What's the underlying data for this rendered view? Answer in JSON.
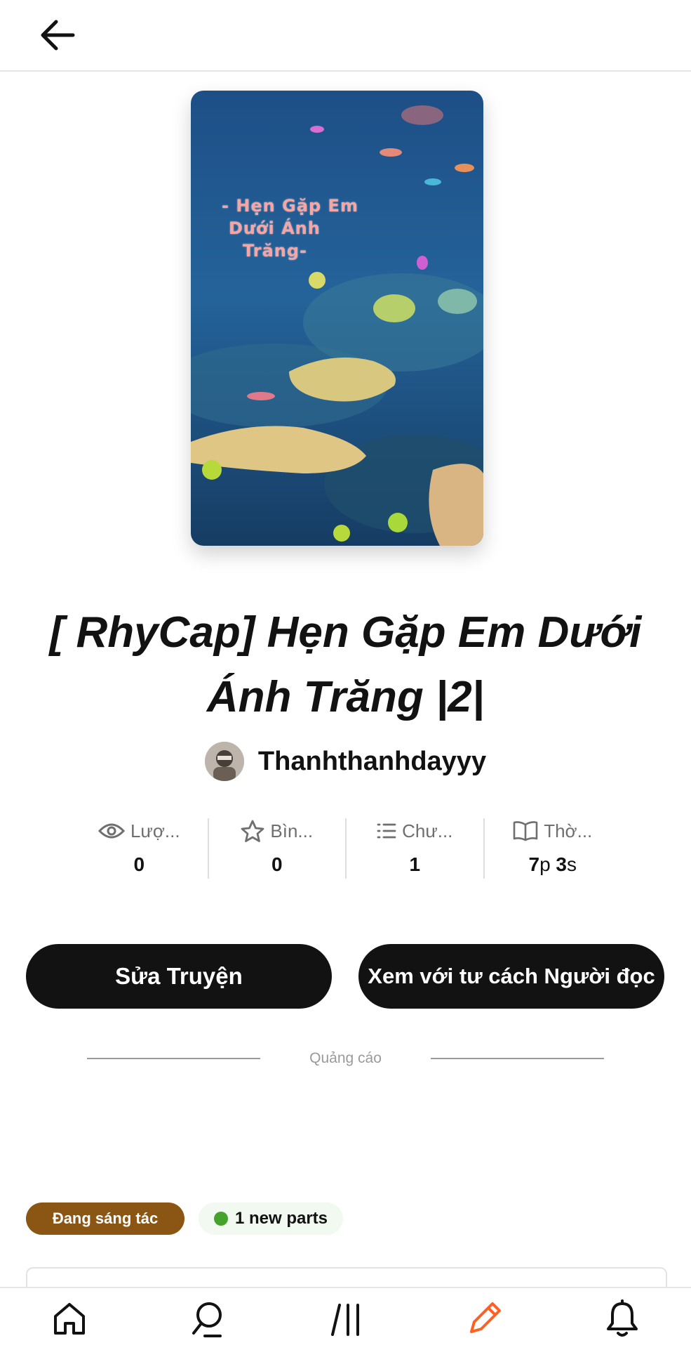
{
  "header": {
    "back_icon": "arrow-left-icon"
  },
  "cover": {
    "text_lines": [
      "- Hẹn Gặp Em",
      "Dưới Ánh",
      "Trăng-"
    ]
  },
  "story": {
    "title": "[ RhyCap] Hẹn Gặp Em Dưới Ánh Trăng |2|",
    "author": "Thanhthanhdayyy"
  },
  "stats": [
    {
      "icon": "eye-icon",
      "label": "Lượ...",
      "value": "0"
    },
    {
      "icon": "star-icon",
      "label": "Bìn...",
      "value": "0"
    },
    {
      "icon": "list-icon",
      "label": "Chư...",
      "value": "1"
    },
    {
      "icon": "book-icon",
      "label": "Thờ...",
      "value_parts": [
        "7",
        "p ",
        "3",
        "s"
      ]
    }
  ],
  "actions": {
    "edit_label": "Sửa Truyện",
    "read_label": "Xem với tư cách Người đọc"
  },
  "ad": {
    "label": "Quảng cáo"
  },
  "badges": {
    "status": "Đang sáng tác",
    "new_parts": "1 new parts"
  },
  "bottom_nav": [
    {
      "icon": "home-icon"
    },
    {
      "icon": "search-icon"
    },
    {
      "icon": "library-icon"
    },
    {
      "icon": "pencil-icon",
      "active": true
    },
    {
      "icon": "bell-icon"
    }
  ],
  "colors": {
    "status_pill": "#8b5513",
    "new_dot": "#45a32b",
    "active_nav": "#ff6122",
    "button_bg": "#121212"
  }
}
